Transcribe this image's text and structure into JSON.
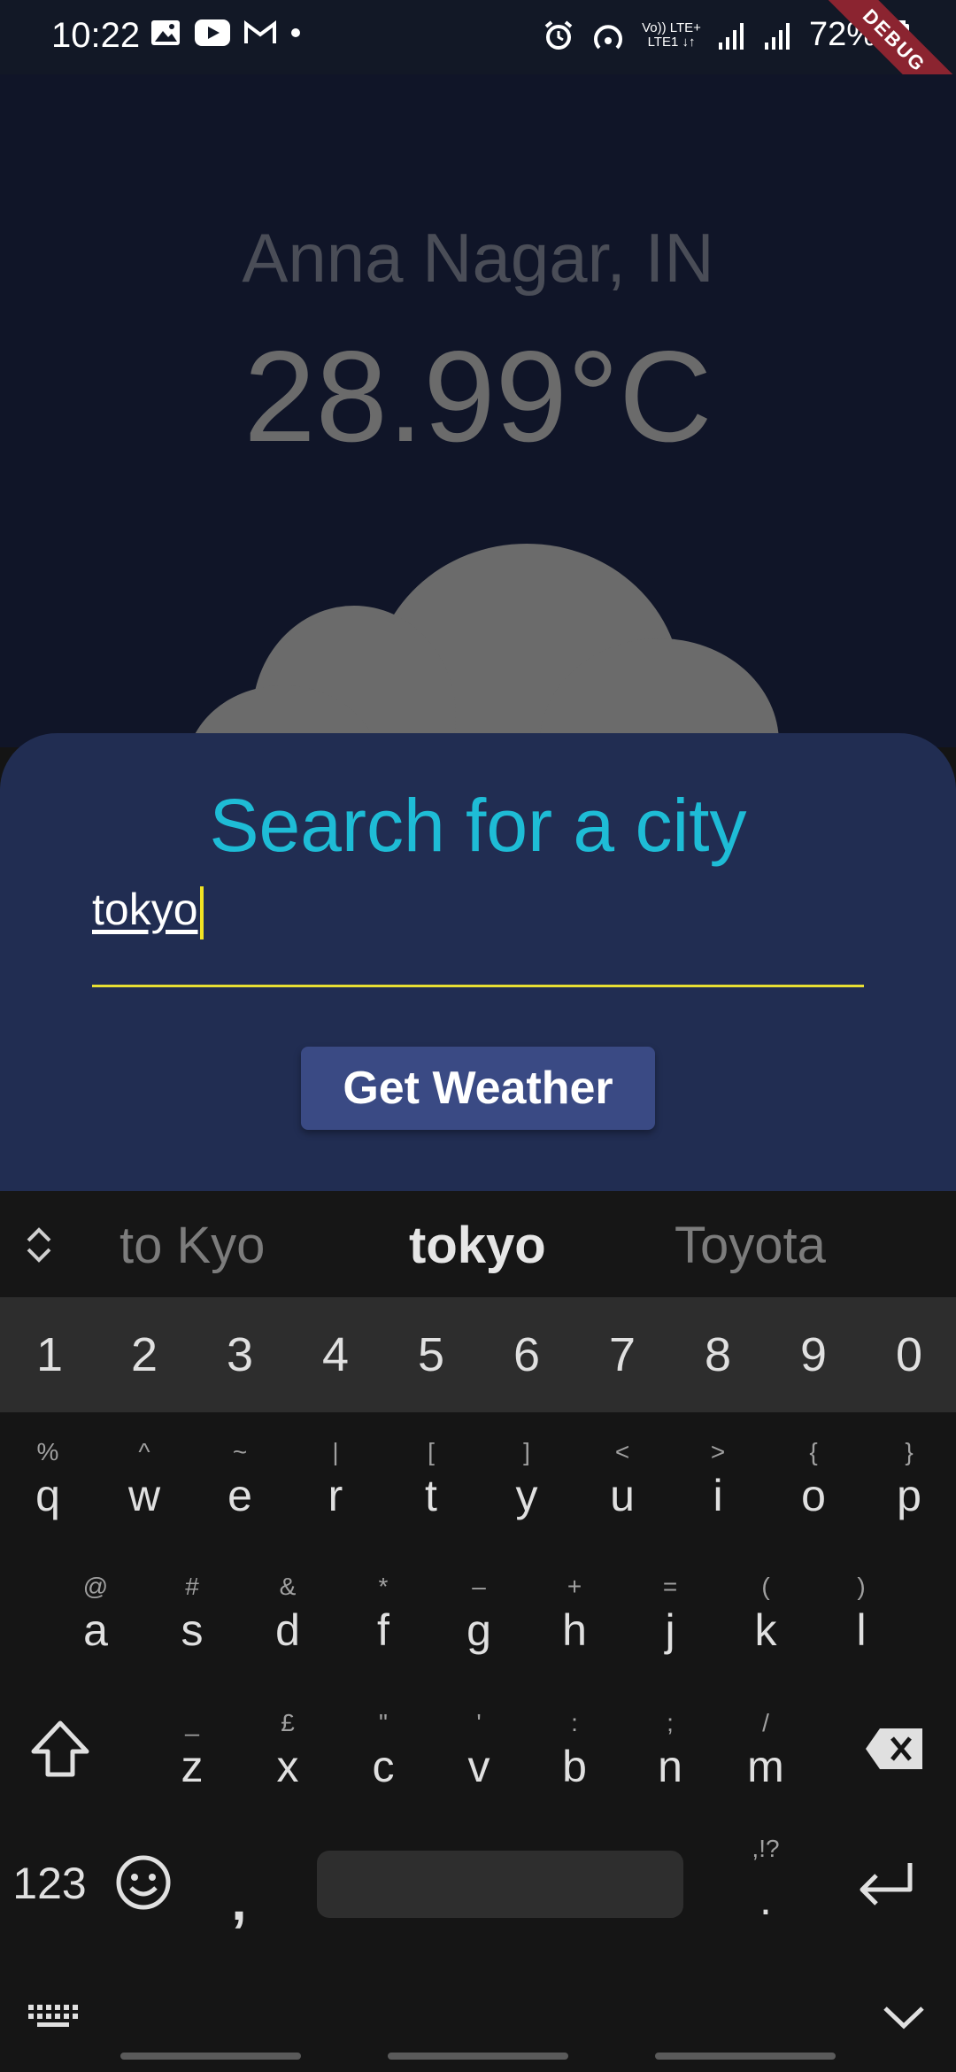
{
  "status_bar": {
    "time": "10:22",
    "battery": "72%",
    "net_top": "Vo)) LTE+",
    "net_bottom": "LTE1 ↓↑",
    "debug_label": "DEBUG"
  },
  "weather": {
    "city": "Anna Nagar, IN",
    "temperature": "28.99°C"
  },
  "sheet": {
    "title": "Search for a city",
    "input_value": "tokyo",
    "button_label": "Get Weather"
  },
  "keyboard": {
    "suggestions": [
      "to Kyo",
      "tokyo",
      "Toyota"
    ],
    "numbers": [
      "1",
      "2",
      "3",
      "4",
      "5",
      "6",
      "7",
      "8",
      "9",
      "0"
    ],
    "row1": [
      "q",
      "w",
      "e",
      "r",
      "t",
      "y",
      "u",
      "i",
      "o",
      "p"
    ],
    "row1_alt": [
      "%",
      "^",
      "~",
      "|",
      "[",
      "]",
      "<",
      ">",
      "{",
      "}"
    ],
    "row2": [
      "a",
      "s",
      "d",
      "f",
      "g",
      "h",
      "j",
      "k",
      "l"
    ],
    "row2_alt": [
      "@",
      "#",
      "&",
      "*",
      "–",
      "+",
      "=",
      "(",
      ")"
    ],
    "row3": [
      "z",
      "x",
      "c",
      "v",
      "b",
      "n",
      "m"
    ],
    "row3_alt": [
      "_",
      "£",
      "\"",
      "'",
      ":",
      ";",
      "/"
    ],
    "sym_key": "123",
    "comma_key": ",",
    "period_key": ".",
    "period_alt": ",!?"
  },
  "colors": {
    "accent": "#1ebcd6",
    "sheet_bg": "#212d52",
    "button_bg": "#3a4a84",
    "input_underline": "#e7df33"
  }
}
